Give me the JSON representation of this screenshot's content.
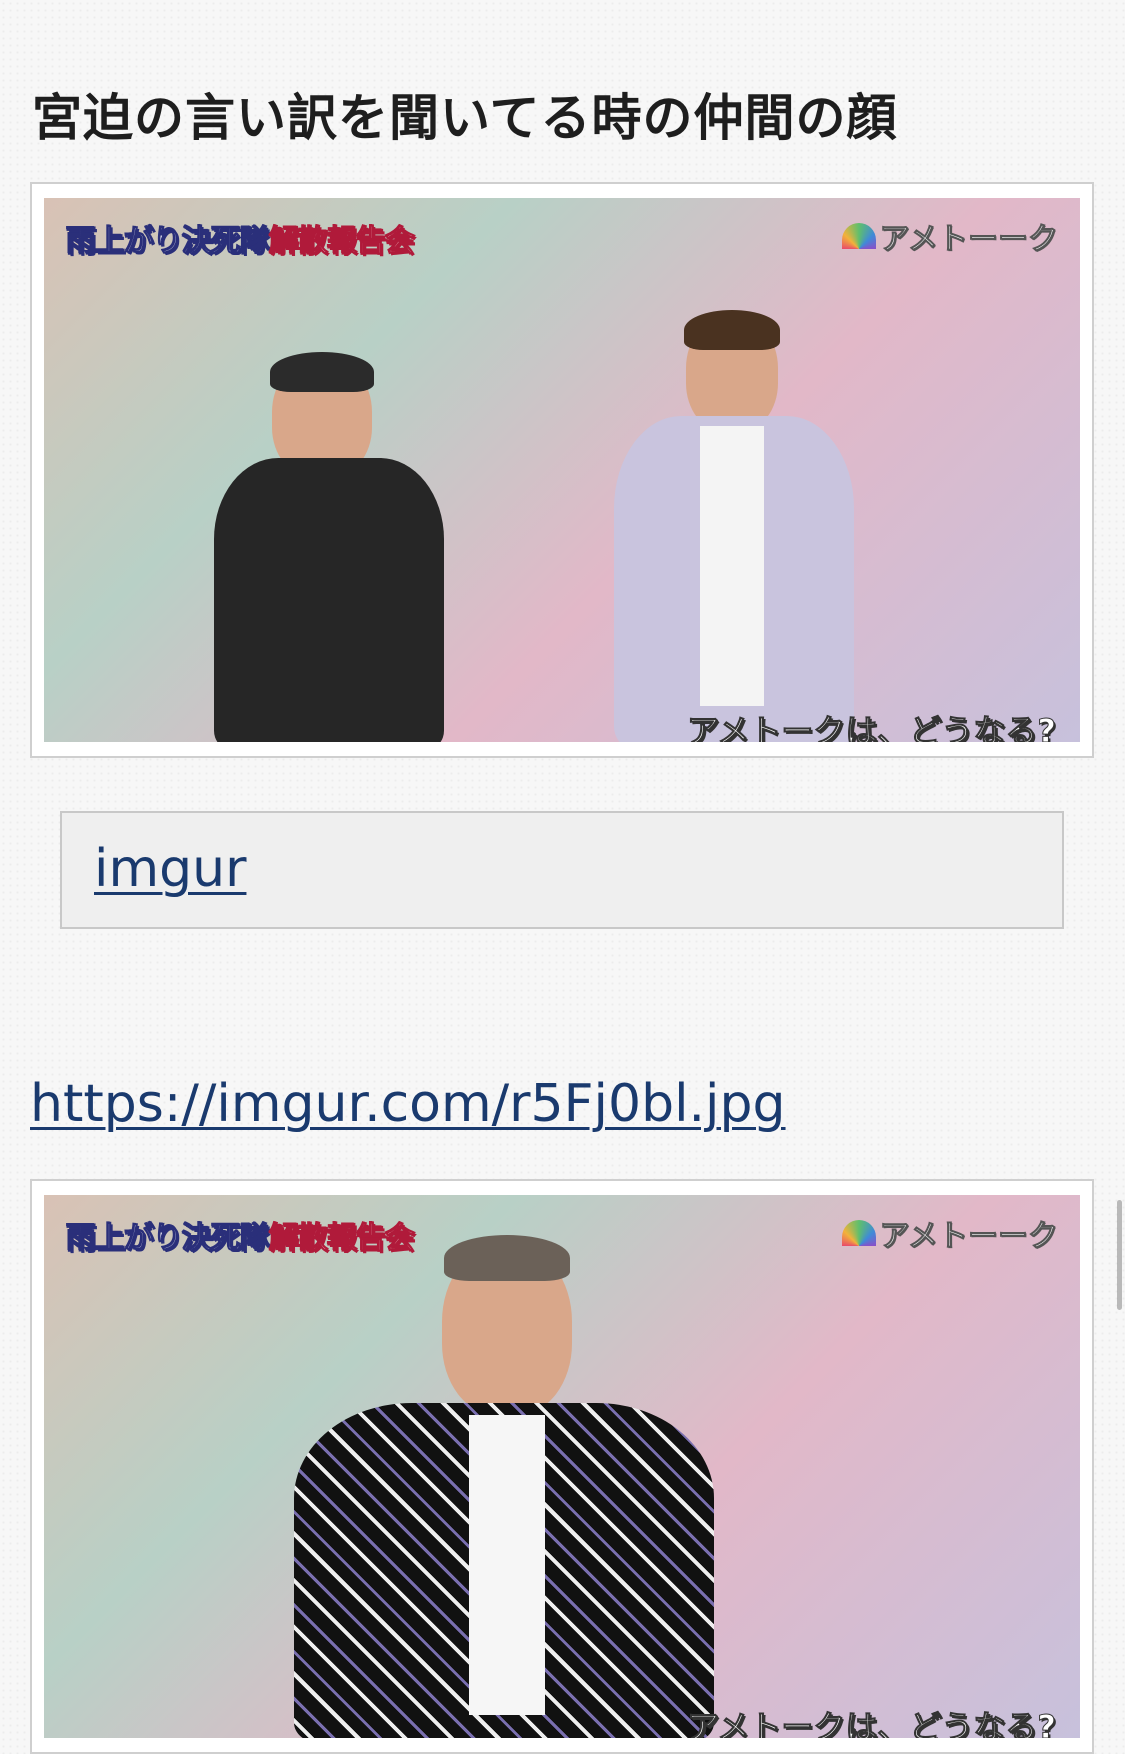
{
  "post": {
    "title": "宮迫の言い訳を聞いてる時の仲間の顔",
    "link_box_label": "imgur",
    "url": "https://imgur.com/r5Fj0bl.jpg"
  },
  "images": [
    {
      "caption_main": "雨上がり決死隊",
      "caption_accent": "解散報告会",
      "logo": "アメトーーク",
      "subtitle": "アメトークは、どうなる?"
    },
    {
      "caption_main": "雨上がり決死隊",
      "caption_accent": "解散報告会",
      "logo": "アメトーーク",
      "subtitle": "アメトークは、どうなる?"
    }
  ]
}
